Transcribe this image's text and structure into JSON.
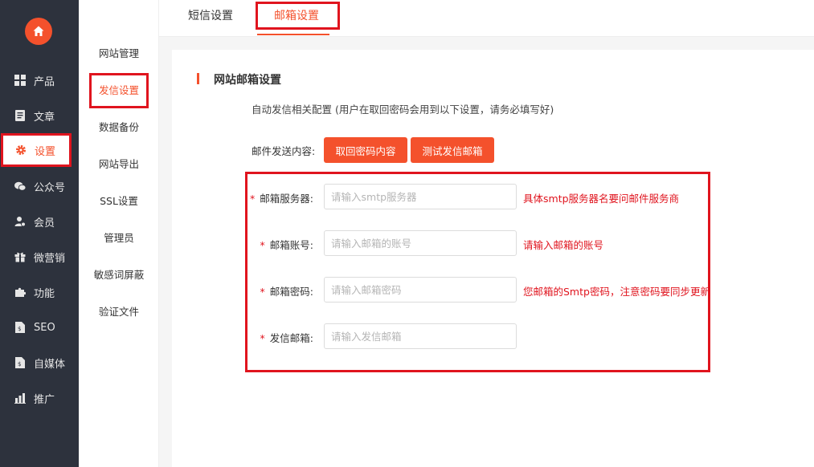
{
  "nav": {
    "items": [
      {
        "label": "产品",
        "icon": "grid-icon"
      },
      {
        "label": "文章",
        "icon": "document-icon"
      },
      {
        "label": "设置",
        "icon": "gear-icon"
      },
      {
        "label": "公众号",
        "icon": "wechat-icon"
      },
      {
        "label": "会员",
        "icon": "user-icon"
      },
      {
        "label": "微营销",
        "icon": "gift-icon"
      },
      {
        "label": "功能",
        "icon": "puzzle-icon"
      },
      {
        "label": "SEO",
        "icon": "seo-doc-icon"
      },
      {
        "label": "自媒体",
        "icon": "media-doc-icon"
      },
      {
        "label": "推广",
        "icon": "bar-chart-icon"
      }
    ],
    "active_index": 2,
    "accent": "#f4512c",
    "background": "#2d323d"
  },
  "subnav": {
    "items": [
      "网站管理",
      "发信设置",
      "数据备份",
      "网站导出",
      "SSL设置",
      "管理员",
      "敏感词屏蔽",
      "验证文件"
    ],
    "active_index": 1
  },
  "tabs": {
    "items": [
      "短信设置",
      "邮箱设置"
    ],
    "active_index": 1
  },
  "section": {
    "title": "网站邮箱设置",
    "description": "自动发信相关配置 (用户在取回密码会用到以下设置，请务必填写好)"
  },
  "send_content": {
    "label": "邮件发送内容:",
    "buttons": [
      "取回密码内容",
      "测试发信邮箱"
    ]
  },
  "form": {
    "fields": [
      {
        "label": "邮箱服务器:",
        "placeholder": "请输入smtp服务器",
        "value": "",
        "hint": "具体smtp服务器名要问邮件服务商"
      },
      {
        "label": "邮箱账号:",
        "placeholder": "请输入邮箱的账号",
        "value": "",
        "hint": "请输入邮箱的账号"
      },
      {
        "label": "邮箱密码:",
        "placeholder": "请输入邮箱密码",
        "value": "",
        "hint": "您邮箱的Smtp密码，注意密码要同步更新"
      },
      {
        "label": "发信邮箱:",
        "placeholder": "请输入发信邮箱",
        "value": "",
        "hint": ""
      }
    ]
  }
}
